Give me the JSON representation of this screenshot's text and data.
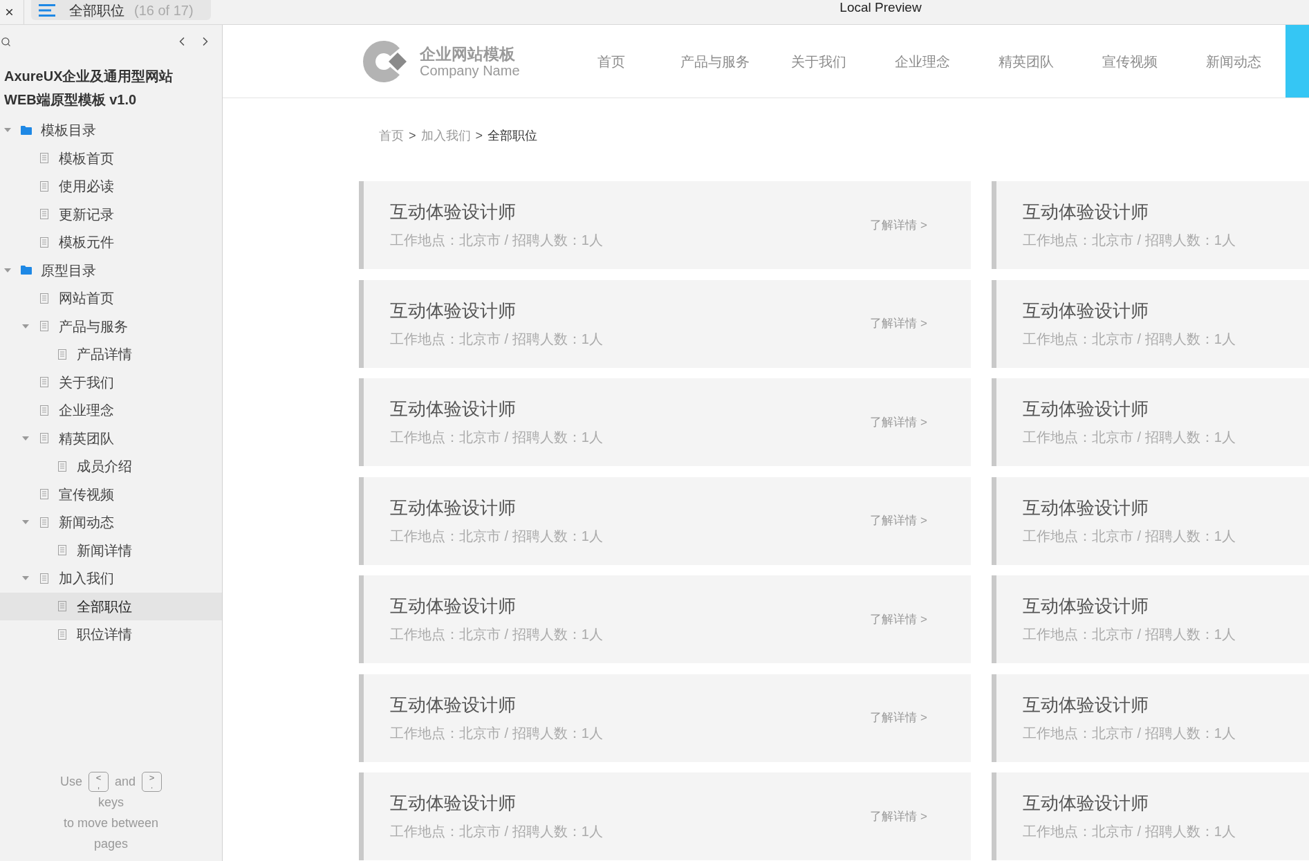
{
  "top_bar": {
    "page_title": "全部职位",
    "page_counter": "(16 of 17)",
    "window_title": "Local Preview"
  },
  "sidebar": {
    "title_lines": [
      "AxureUX企业及通用型网站",
      "WEB端原型模板 v1.0"
    ],
    "tree": [
      {
        "label": "模板目录",
        "kind": "folder",
        "selected": false,
        "expanded": true,
        "children": [
          {
            "label": "模板首页",
            "kind": "page",
            "selected": false
          },
          {
            "label": "使用必读",
            "kind": "page",
            "selected": false
          },
          {
            "label": "更新记录",
            "kind": "page",
            "selected": false
          },
          {
            "label": "模板元件",
            "kind": "page",
            "selected": false
          }
        ]
      },
      {
        "label": "原型目录",
        "kind": "folder",
        "selected": false,
        "expanded": true,
        "children": [
          {
            "label": "网站首页",
            "kind": "page",
            "selected": false
          },
          {
            "label": "产品与服务",
            "kind": "page",
            "selected": false,
            "expanded": true,
            "children": [
              {
                "label": "产品详情",
                "kind": "page",
                "selected": false
              }
            ]
          },
          {
            "label": "关于我们",
            "kind": "page",
            "selected": false
          },
          {
            "label": "企业理念",
            "kind": "page",
            "selected": false
          },
          {
            "label": "精英团队",
            "kind": "page",
            "selected": false,
            "expanded": true,
            "children": [
              {
                "label": "成员介绍",
                "kind": "page",
                "selected": false
              }
            ]
          },
          {
            "label": "宣传视频",
            "kind": "page",
            "selected": false
          },
          {
            "label": "新闻动态",
            "kind": "page",
            "selected": false,
            "expanded": true,
            "children": [
              {
                "label": "新闻详情",
                "kind": "page",
                "selected": false
              }
            ]
          },
          {
            "label": "加入我们",
            "kind": "page",
            "selected": false,
            "expanded": true,
            "children": [
              {
                "label": "全部职位",
                "kind": "page",
                "selected": true
              },
              {
                "label": "职位详情",
                "kind": "page",
                "selected": false
              }
            ]
          }
        ]
      }
    ],
    "hint": {
      "before": "Use",
      "prev_key": {
        "top": "<",
        "bottom": ","
      },
      "middle": "and",
      "next_key": {
        "top": ">",
        "bottom": "."
      },
      "after_lines": [
        "keys",
        "to move between",
        "pages"
      ]
    }
  },
  "header": {
    "logo": {
      "name": "企业网站模板",
      "tagline": "Company Name"
    },
    "nav": [
      {
        "label": "首页",
        "selected": false
      },
      {
        "label": "产品与服务",
        "selected": false
      },
      {
        "label": "关于我们",
        "selected": false
      },
      {
        "label": "企业理念",
        "selected": false
      },
      {
        "label": "精英团队",
        "selected": false
      },
      {
        "label": "宣传视频",
        "selected": false
      },
      {
        "label": "新闻动态",
        "selected": false
      }
    ],
    "active_item_cut_off": true
  },
  "breadcrumb": [
    {
      "kind": "link",
      "text": "首页"
    },
    {
      "kind": "separator",
      "text": ">"
    },
    {
      "kind": "link",
      "text": "加入我们"
    },
    {
      "kind": "separator",
      "text": ">"
    },
    {
      "kind": "current",
      "text": "全部职位"
    }
  ],
  "job_cards": [
    {
      "title": "互动体验设计师",
      "details": "工作地点：北京市 / 招聘人数：1人",
      "link": "了解详情 >"
    },
    {
      "title": "互动体验设计师",
      "details": "工作地点：北京市 / 招聘人数：1人"
    },
    {
      "title": "互动体验设计师",
      "details": "工作地点：北京市 / 招聘人数：1人",
      "link": "了解详情 >"
    },
    {
      "title": "互动体验设计师",
      "details": "工作地点：北京市 / 招聘人数：1人"
    },
    {
      "title": "互动体验设计师",
      "details": "工作地点：北京市 / 招聘人数：1人",
      "link": "了解详情 >"
    },
    {
      "title": "互动体验设计师",
      "details": "工作地点：北京市 / 招聘人数：1人"
    },
    {
      "title": "互动体验设计师",
      "details": "工作地点：北京市 / 招聘人数：1人",
      "link": "了解详情 >"
    },
    {
      "title": "互动体验设计师",
      "details": "工作地点：北京市 / 招聘人数：1人"
    },
    {
      "title": "互动体验设计师",
      "details": "工作地点：北京市 / 招聘人数：1人",
      "link": "了解详情 >"
    },
    {
      "title": "互动体验设计师",
      "details": "工作地点：北京市 / 招聘人数：1人"
    },
    {
      "title": "互动体验设计师",
      "details": "工作地点：北京市 / 招聘人数：1人",
      "link": "了解详情 >"
    },
    {
      "title": "互动体验设计师",
      "details": "工作地点：北京市 / 招聘人数：1人"
    },
    {
      "title": "互动体验设计师",
      "details": "工作地点：北京市 / 招聘人数：1人",
      "link": "了解详情 >"
    },
    {
      "title": "互动体验设计师",
      "details": "工作地点：北京市 / 招聘人数：1人"
    }
  ]
}
